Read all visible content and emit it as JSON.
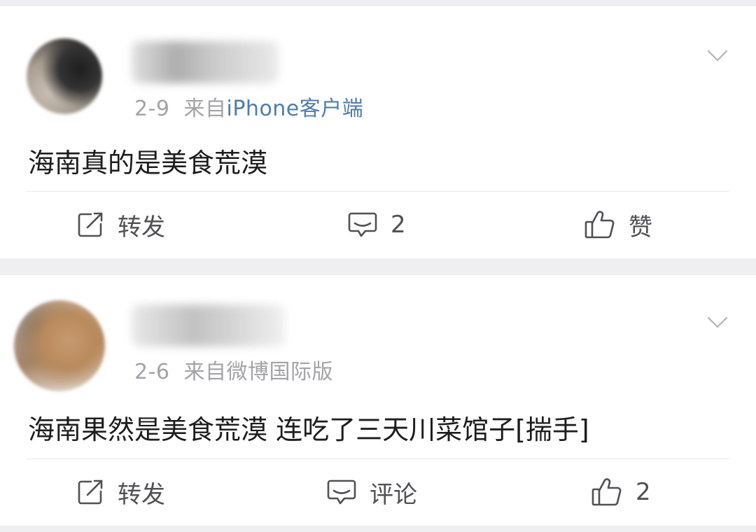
{
  "posts": [
    {
      "date": "2-9",
      "source_prefix": "来自",
      "source_name": "iPhone客户端",
      "content": "海南真的是美食荒漠",
      "actions": {
        "repost_label": "转发",
        "comment_label": "2",
        "like_label": "赞"
      }
    },
    {
      "date": "2-6",
      "source_prefix": "来自",
      "source_name": "微博国际版",
      "content": "海南果然是美食荒漠 连吃了三天川菜馆子[揣手]",
      "actions": {
        "repost_label": "转发",
        "comment_label": "评论",
        "like_label": "2"
      }
    }
  ],
  "colors": {
    "page_background": "#efeff1",
    "card_background": "#ffffff",
    "meta_gray": "#a3a3a8",
    "source_link_blue": "#4f7cae",
    "icon_gray": "#505055",
    "content_text": "#1d1d1d"
  },
  "icons": {
    "more": "chevron-down-icon",
    "repost": "edit-share-icon",
    "comment": "comment-bubble-icon",
    "like": "thumbs-up-icon"
  }
}
